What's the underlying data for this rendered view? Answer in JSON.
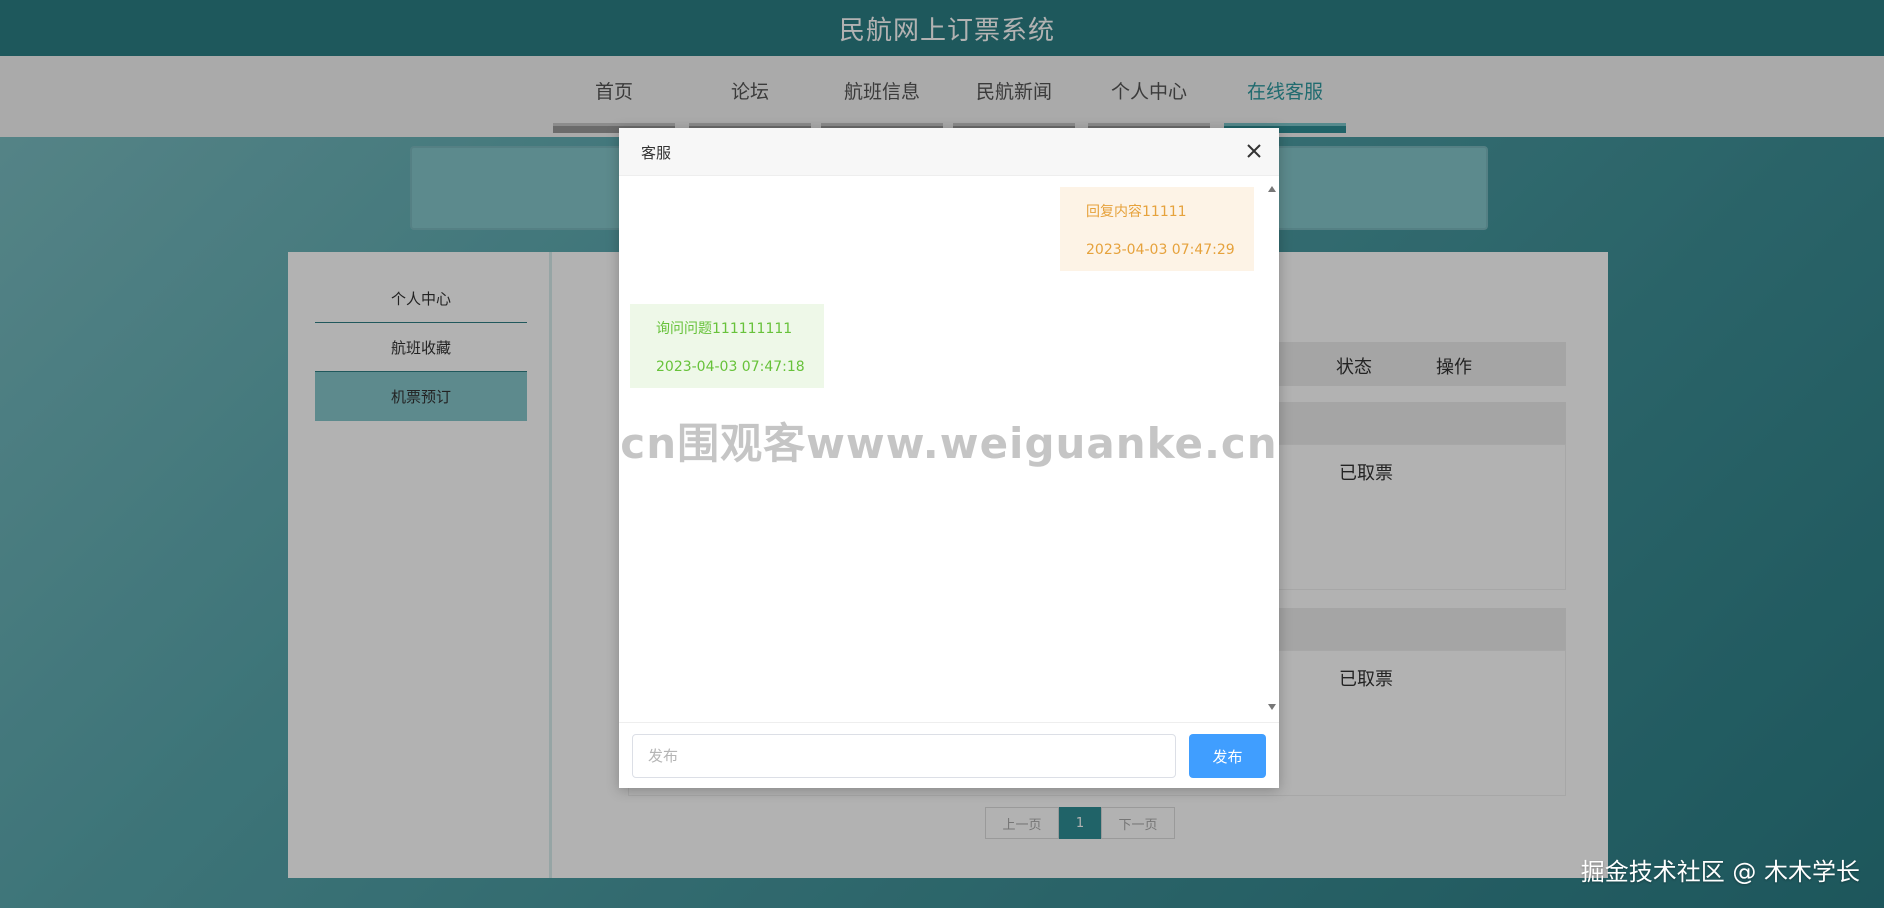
{
  "header": {
    "title": "民航网上订票系统"
  },
  "nav": {
    "items": [
      {
        "label": "首页"
      },
      {
        "label": "论坛"
      },
      {
        "label": "航班信息"
      },
      {
        "label": "民航新闻"
      },
      {
        "label": "个人中心"
      },
      {
        "label": "在线客服"
      }
    ],
    "active_item": "在线客服"
  },
  "sidebar": {
    "items": [
      {
        "label": "个人中心"
      },
      {
        "label": "航班收藏"
      },
      {
        "label": "机票预订"
      }
    ],
    "active_item": "机票预订"
  },
  "table": {
    "columns": [
      "状态",
      "操作"
    ],
    "rows": [
      {
        "status": "已取票"
      },
      {
        "status": "已取票"
      }
    ]
  },
  "pagination": {
    "prev": "上一页",
    "current": "1",
    "next": "下一页"
  },
  "modal": {
    "title": "客服",
    "messages": [
      {
        "role": "reply",
        "text": "回复内容11111",
        "time": "2023-04-03 07:47:29"
      },
      {
        "role": "ask",
        "text": "询问问题111111111",
        "time": "2023-04-03 07:47:18"
      }
    ],
    "input": {
      "placeholder": "发布",
      "value": ""
    },
    "send_label": "发布"
  },
  "watermark": "cn围观客www.weiguanke.cn",
  "credit": "掘金技术社区 @ 木木学长",
  "colors": {
    "header_bg": "#2b7f84",
    "accent": "#2e8f95",
    "send_button": "#409eff",
    "reply_text": "#e6a23c",
    "ask_text": "#67c23a"
  }
}
